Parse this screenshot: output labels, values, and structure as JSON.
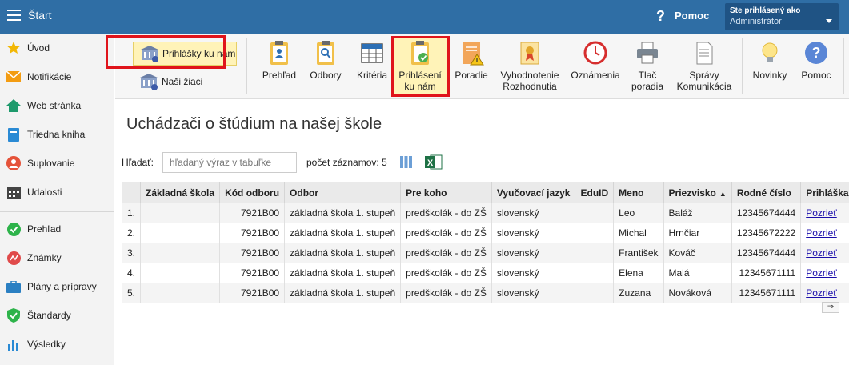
{
  "header": {
    "title": "Štart",
    "help_label": "Pomoc",
    "login_title": "Ste prihlásený ako",
    "login_user": "Administrátor"
  },
  "sidebar": {
    "items": [
      {
        "label": "Úvod",
        "icon": "star-icon"
      },
      {
        "label": "Notifikácie",
        "icon": "envelope-icon"
      },
      {
        "label": "Web stránka",
        "icon": "home-icon"
      },
      {
        "label": "Triedna kniha",
        "icon": "book-icon"
      },
      {
        "label": "Suplovanie",
        "icon": "user-icon"
      },
      {
        "label": "Udalosti",
        "icon": "calendar-icon"
      },
      {
        "label": "Prehľad",
        "icon": "check-circle-icon"
      },
      {
        "label": "Známky",
        "icon": "grades-icon"
      },
      {
        "label": "Plány a prípravy",
        "icon": "briefcase-icon"
      },
      {
        "label": "Štandardy",
        "icon": "shield-icon"
      },
      {
        "label": "Výsledky",
        "icon": "bar-chart-icon"
      }
    ]
  },
  "toolbar": {
    "prihlasky_label": "Prihlášky ku nám",
    "nasi_ziaci_label": "Naši žiaci",
    "prehlad": "Prehľad",
    "odbory": "Odbory",
    "kriteria": "Kritéria",
    "prihlaseni_1": "Prihlásení",
    "prihlaseni_2": "ku nám",
    "poradie": "Poradie",
    "vyhodnotenie_1": "Vyhodnotenie",
    "vyhodnotenie_2": "Rozhodnutia",
    "oznamenia": "Oznámenia",
    "tlac_1": "Tlač",
    "tlac_2": "poradia",
    "spravy_1": "Správy",
    "spravy_2": "Komunikácia",
    "novinky": "Novinky",
    "pomoc": "Pomoc"
  },
  "main": {
    "title": "Uchádzači o štúdium na našej škole",
    "search_label": "Hľadať:",
    "search_placeholder": "hľadaný výraz v tabuľke",
    "count_label": "počet záznamov: 5"
  },
  "table": {
    "headers": [
      "",
      "Základná škola",
      "Kód odboru",
      "Odbor",
      "Pre koho",
      "Vyučovací jazyk",
      "EduID",
      "Meno",
      "Priezvisko",
      "Rodné číslo",
      "Prihláška"
    ],
    "sort_indicator": "▲",
    "rows": [
      {
        "n": "1.",
        "skola": "",
        "kod": "7921B00",
        "odbor": "základná škola 1. stupeň",
        "pre": "predškolák - do ZŠ",
        "jazyk": "slovenský",
        "eduid": "",
        "meno": "Leo",
        "priezvisko": "Baláž",
        "rc": "12345674444",
        "link": "Pozrieť"
      },
      {
        "n": "2.",
        "skola": "",
        "kod": "7921B00",
        "odbor": "základná škola 1. stupeň",
        "pre": "predškolák - do ZŠ",
        "jazyk": "slovenský",
        "eduid": "",
        "meno": "Michal",
        "priezvisko": "Hrnčiar",
        "rc": "12345672222",
        "link": "Pozrieť"
      },
      {
        "n": "3.",
        "skola": "",
        "kod": "7921B00",
        "odbor": "základná škola 1. stupeň",
        "pre": "predškolák - do ZŠ",
        "jazyk": "slovenský",
        "eduid": "",
        "meno": "František",
        "priezvisko": "Kováč",
        "rc": "12345674444",
        "link": "Pozrieť"
      },
      {
        "n": "4.",
        "skola": "",
        "kod": "7921B00",
        "odbor": "základná škola 1. stupeň",
        "pre": "predškolák - do ZŠ",
        "jazyk": "slovenský",
        "eduid": "",
        "meno": "Elena",
        "priezvisko": "Malá",
        "rc": "12345671111",
        "link": "Pozrieť"
      },
      {
        "n": "5.",
        "skola": "",
        "kod": "7921B00",
        "odbor": "základná škola 1. stupeň",
        "pre": "predškolák - do ZŠ",
        "jazyk": "slovenský",
        "eduid": "",
        "meno": "Zuzana",
        "priezvisko": "Nováková",
        "rc": "12345671111",
        "link": "Pozrieť"
      }
    ],
    "scroll_glyph": "⇒"
  }
}
